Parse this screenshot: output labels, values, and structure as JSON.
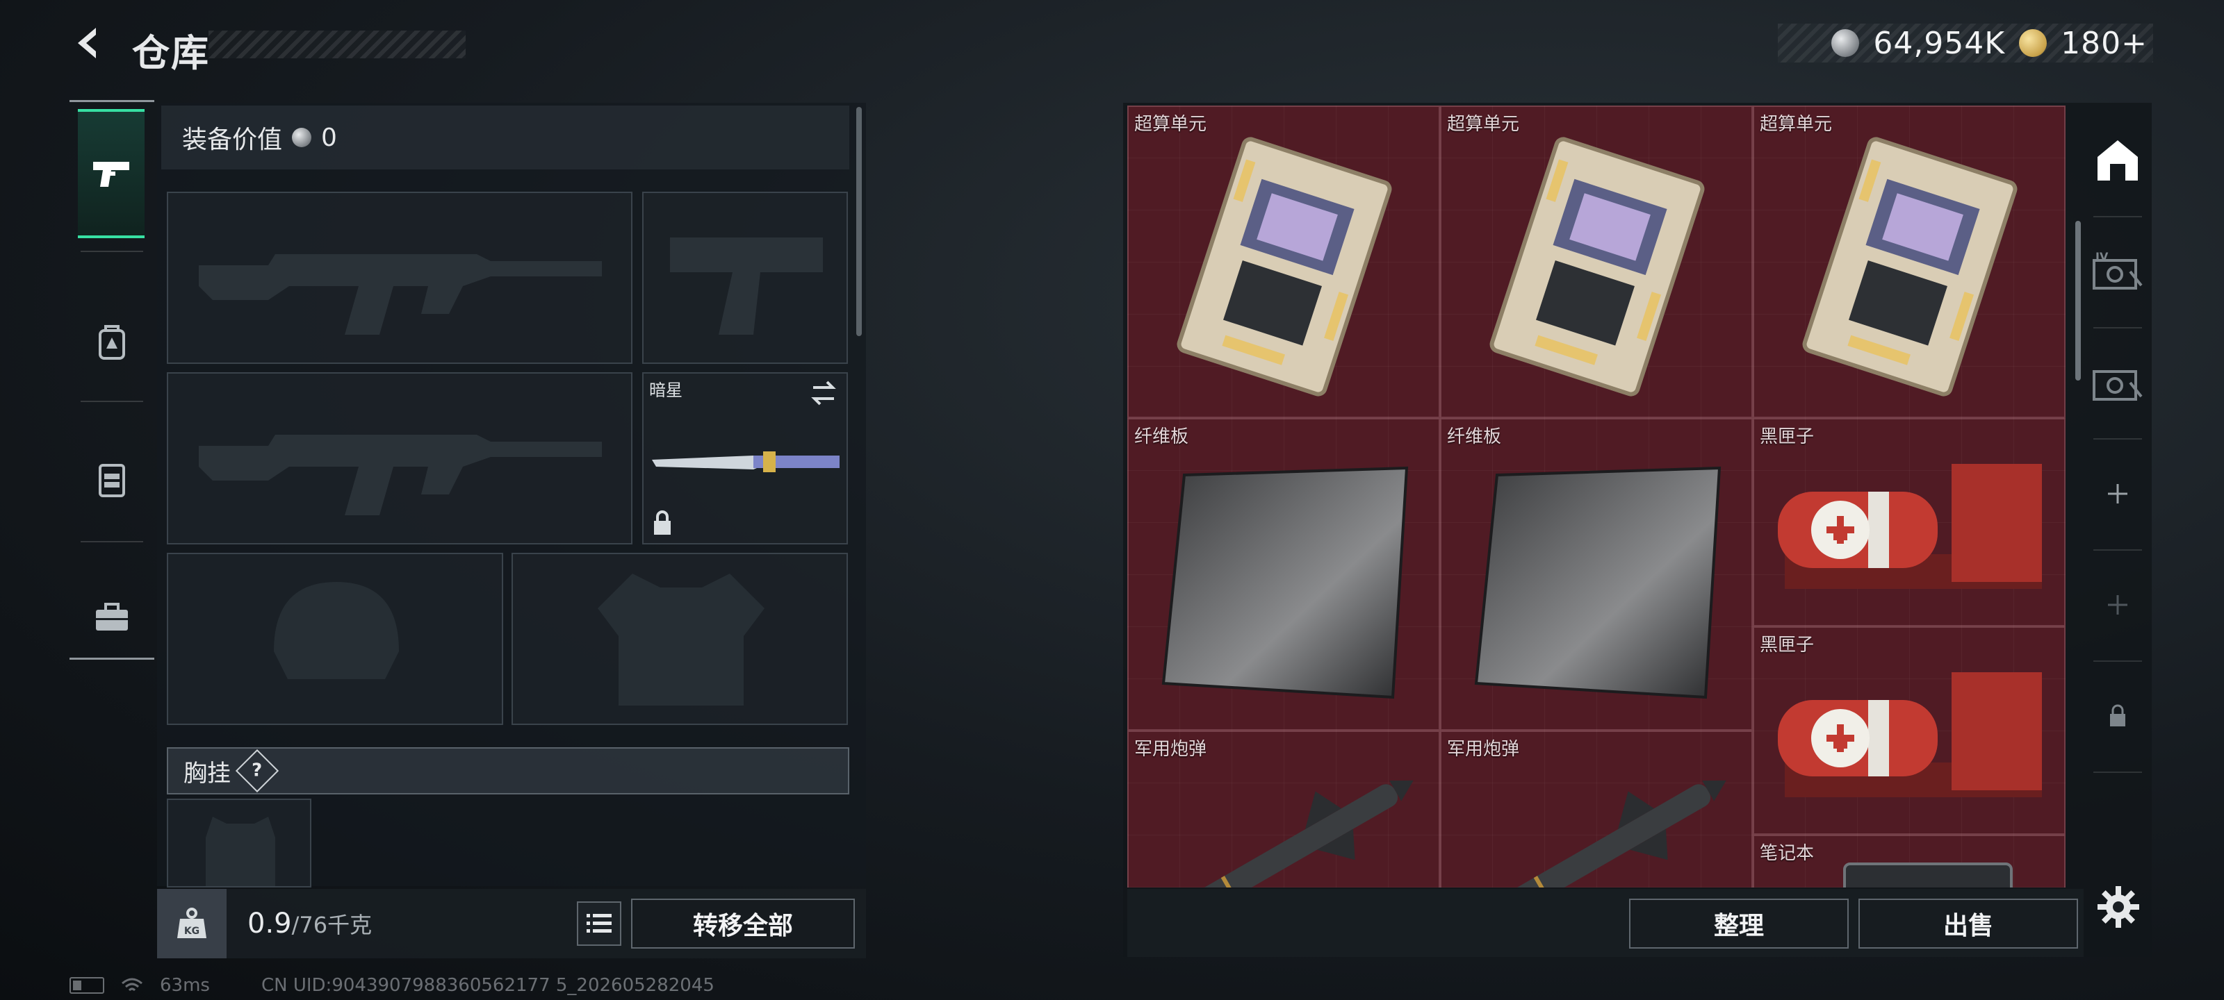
{
  "header": {
    "title": "仓库",
    "currency": [
      {
        "icon": "silver-coin-icon",
        "value": "64,954K"
      },
      {
        "icon": "gold-coin-icon",
        "value": "180+"
      }
    ]
  },
  "left_rail": {
    "items": [
      {
        "icon": "pistol-icon",
        "active": true
      },
      {
        "icon": "backpack-icon",
        "active": false
      },
      {
        "icon": "vest-icon",
        "active": false
      },
      {
        "icon": "briefcase-icon",
        "active": false
      }
    ]
  },
  "equipment": {
    "value_label": "装备价值",
    "value": "0",
    "melee_slot_label": "暗星",
    "chest_label": "胸挂",
    "chest_help": "?",
    "weight_current": "0.9",
    "weight_capacity": "/76千克",
    "kg_icon_label": "KG",
    "transfer_all_label": "转移全部"
  },
  "stash": {
    "items": [
      {
        "label": "超算单元",
        "type": "circuit-board"
      },
      {
        "label": "超算单元",
        "type": "circuit-board"
      },
      {
        "label": "超算单元",
        "type": "circuit-board"
      },
      {
        "label": "纤维板",
        "type": "fiber-board"
      },
      {
        "label": "纤维板",
        "type": "fiber-board"
      },
      {
        "label": "黑匣子",
        "type": "black-box"
      },
      {
        "label": "黑匣子",
        "type": "black-box"
      },
      {
        "label": "军用炮弹",
        "type": "missile"
      },
      {
        "label": "军用炮弹",
        "type": "missile"
      },
      {
        "label": "笔记本",
        "type": "laptop"
      }
    ],
    "organize_label": "整理",
    "sell_label": "出售"
  },
  "status": {
    "ping": "63ms",
    "uid": "CN UID:9043907988360562177 5_202605282045"
  },
  "colors": {
    "accent": "#37e0a3",
    "stash_bg": "#4a1b22"
  }
}
